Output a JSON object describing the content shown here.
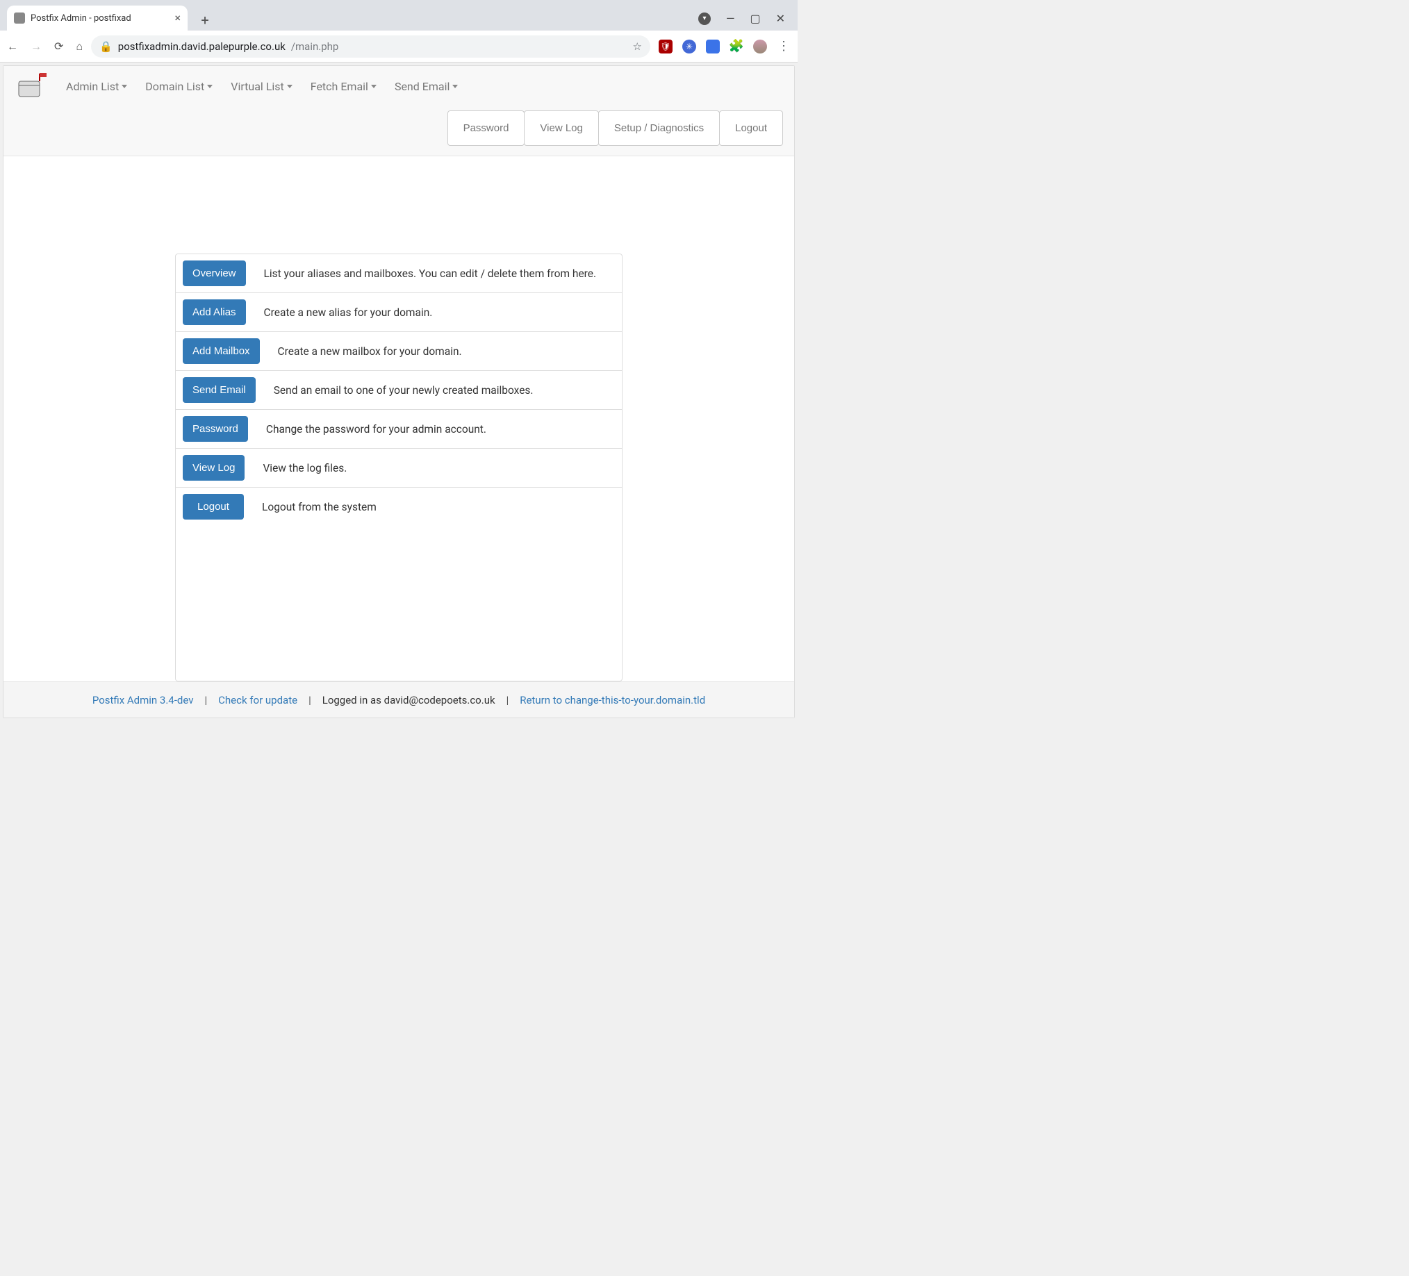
{
  "browser": {
    "tab_title": "Postfix Admin - postfixad",
    "url_host": "postfixadmin.david.palepurple.co.uk",
    "url_path": "/main.php"
  },
  "nav": {
    "items": [
      "Admin List",
      "Domain List",
      "Virtual List",
      "Fetch Email",
      "Send Email"
    ],
    "buttons": [
      "Password",
      "View Log",
      "Setup / Diagnostics",
      "Logout"
    ]
  },
  "panel": [
    {
      "label": "Overview",
      "desc": "List your aliases and mailboxes. You can edit / delete them from here."
    },
    {
      "label": "Add Alias",
      "desc": "Create a new alias for your domain."
    },
    {
      "label": "Add Mailbox",
      "desc": "Create a new mailbox for your domain."
    },
    {
      "label": "Send Email",
      "desc": "Send an email to one of your newly created mailboxes."
    },
    {
      "label": "Password",
      "desc": "Change the password for your admin account."
    },
    {
      "label": "View Log",
      "desc": "View the log files."
    },
    {
      "label": "Logout",
      "desc": "Logout from the system"
    }
  ],
  "footer": {
    "version_link": "Postfix Admin 3.4-dev",
    "check_update": "Check for update",
    "logged_in": "Logged in as david@codepoets.co.uk",
    "return_link": "Return to change-this-to-your.domain.tld"
  }
}
